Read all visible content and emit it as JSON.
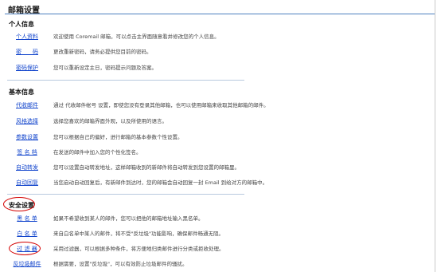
{
  "page": {
    "title": "邮箱设置"
  },
  "sections": [
    {
      "title": "个人信息",
      "items": [
        {
          "label": "个人资料",
          "desc": "欢迎使用 Coremail 邮箱，可以点击主界面随意看并修改您的个人信息。"
        },
        {
          "label": "密　　码",
          "desc": "更改重新密码，请务必提供您目前的密码。"
        },
        {
          "label": "密码保护",
          "desc": "您可以重新设定主日，密码提示问题及答案。"
        }
      ]
    },
    {
      "title": "基本信息",
      "items": [
        {
          "label": "代收邮件",
          "desc": "通过 代收邮件帐号 设置，即使您没有登录其他邮箱，也可以使用邮箱来收取其他邮箱的邮件。"
        },
        {
          "label": "风格选择",
          "desc": "选择您喜欢的邮箱界面外观，以及所使用的语言。"
        },
        {
          "label": "参数设置",
          "desc": "您可以根据自己的偏好，进行邮箱的基本参数个性设置。"
        },
        {
          "label": "签 名 档",
          "desc": "在发送的邮件中加入您的个性化签名。"
        },
        {
          "label": "自动转发",
          "desc": "您可以设置自动转发地址，这样邮箱收到的新邮件将自动转发到您设置的邮箱里。"
        },
        {
          "label": "自动回复",
          "desc": "当您启动自动回复后，有新邮件到达时，您的邮箱会自动回复一封 Email 到给对方的邮箱中。"
        }
      ]
    },
    {
      "title": "安全设置",
      "items": [
        {
          "label": "黑 名 单",
          "desc": "如果不希望收到某人的邮件，您可以把他的邮箱地址输入黑名单。"
        },
        {
          "label": "白 名 单",
          "desc": "来自白名单中某人的邮件，将不受\"反垃圾\"功能影响，确保邮件畅通无阻。"
        },
        {
          "label": "过 滤 器",
          "desc": "采用过滤器，可以根据多种条件，将方便地归类邮件进行分类或拒收处理。"
        },
        {
          "label": "反垃圾邮件",
          "desc": "根据需要，设置\"反垃圾\"，可以有效防止垃圾邮件的骚扰。"
        }
      ]
    }
  ],
  "annotations": {
    "color": "#d40000"
  }
}
